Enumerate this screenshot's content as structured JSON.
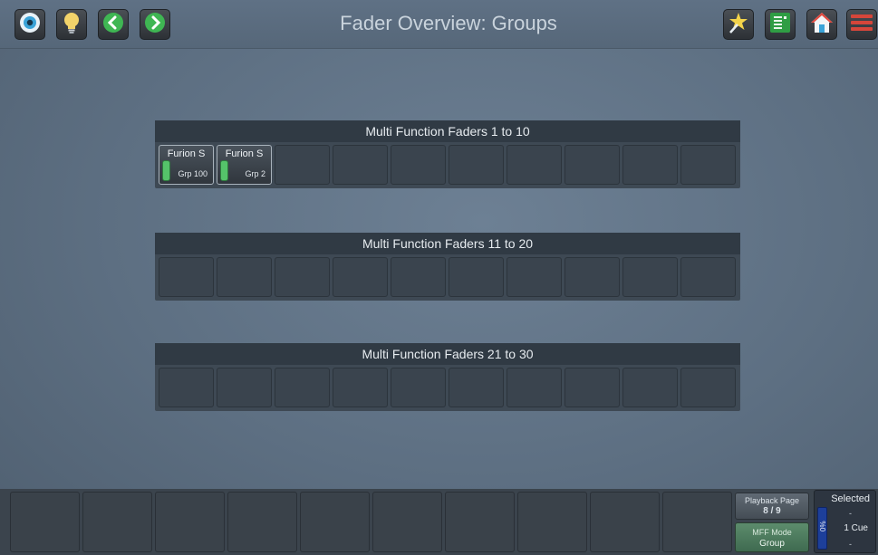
{
  "header": {
    "title": "Fader Overview: Groups",
    "left_buttons": [
      {
        "name": "eye-icon",
        "color": "#3aa3d8"
      },
      {
        "name": "lightbulb-icon",
        "color": "#f2d36a"
      },
      {
        "name": "chevron-left-icon",
        "color": "#3fb653"
      },
      {
        "name": "chevron-right-icon",
        "color": "#3fb653"
      }
    ],
    "right_buttons": [
      {
        "name": "magic-wand-icon",
        "color": "#f3d34a"
      },
      {
        "name": "cue-list-icon",
        "color": "#2f9d44"
      },
      {
        "name": "home-icon",
        "color": "#e24a3f"
      },
      {
        "name": "hamburger-menu-icon",
        "color": "#d6463a"
      }
    ]
  },
  "fader_groups": [
    {
      "title": "Multi Function Faders 1 to 10",
      "slots": [
        {
          "label": "Furion S",
          "sub": "Grp 100",
          "level_color": "#55c36a"
        },
        {
          "label": "Furion S",
          "sub": "Grp 2",
          "level_color": "#55c36a"
        },
        {},
        {},
        {},
        {},
        {},
        {},
        {},
        {}
      ]
    },
    {
      "title": "Multi Function Faders 11 to 20",
      "slots": [
        {},
        {},
        {},
        {},
        {},
        {},
        {},
        {},
        {},
        {}
      ]
    },
    {
      "title": "Multi Function Faders 21 to 30",
      "slots": [
        {},
        {},
        {},
        {},
        {},
        {},
        {},
        {},
        {},
        {}
      ]
    }
  ],
  "bottom": {
    "playback_page": {
      "label": "Playback Page",
      "value": "8 / 9"
    },
    "mff_mode": {
      "label": "MFF Mode",
      "value": "Group"
    },
    "selected": {
      "title": "Selected",
      "level": "0%",
      "line1": "-",
      "cue": "1 Cue",
      "line2": "-"
    }
  }
}
